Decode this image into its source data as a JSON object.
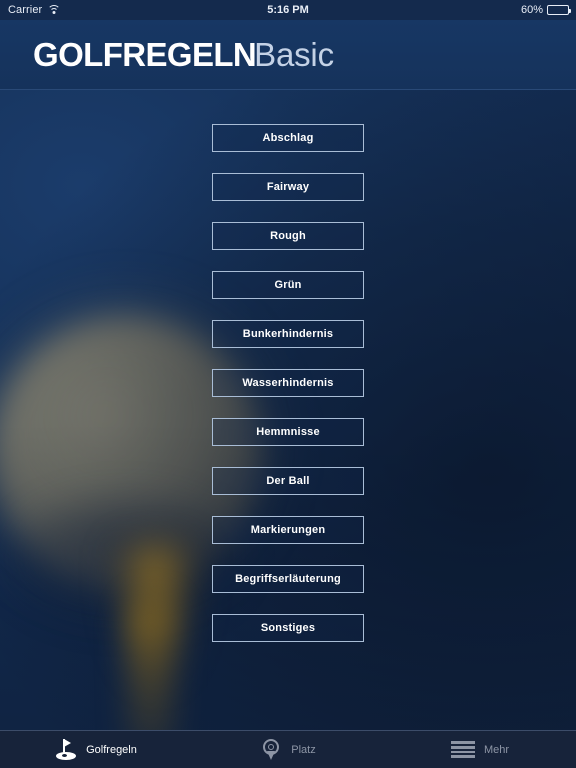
{
  "status_bar": {
    "carrier": "Carrier",
    "wifi_icon": "wifi-icon",
    "time": "5:16 PM",
    "battery_percent": "60%",
    "battery_level": 60,
    "battery_icon": "battery-icon"
  },
  "header": {
    "brand_bold": "GOLFREGELN",
    "brand_light": "Basic"
  },
  "menu": {
    "items": [
      {
        "label": "Abschlag"
      },
      {
        "label": "Fairway"
      },
      {
        "label": "Rough"
      },
      {
        "label": "Grün"
      },
      {
        "label": "Bunkerhindernis"
      },
      {
        "label": "Wasserhindernis"
      },
      {
        "label": "Hemmnisse"
      },
      {
        "label": "Der Ball"
      },
      {
        "label": "Markierungen"
      },
      {
        "label": "Begriffserläuterung"
      },
      {
        "label": "Sonstiges"
      }
    ]
  },
  "tabbar": {
    "tabs": [
      {
        "label": "Golfregeln",
        "icon": "golf-flag-icon",
        "active": true
      },
      {
        "label": "Platz",
        "icon": "map-pin-icon",
        "active": false
      },
      {
        "label": "Mehr",
        "icon": "hamburger-menu-icon",
        "active": false
      }
    ]
  },
  "colors": {
    "background_navy": "#143058",
    "header_navy": "#15325b",
    "button_border": "#a9bdd6",
    "tabbar_dark": "#17233a",
    "tab_inactive_text": "#8d95a5",
    "tab_active_text": "#ffffff",
    "tee_gold": "#c4962a",
    "ball_grey": "#8e8c7c"
  }
}
